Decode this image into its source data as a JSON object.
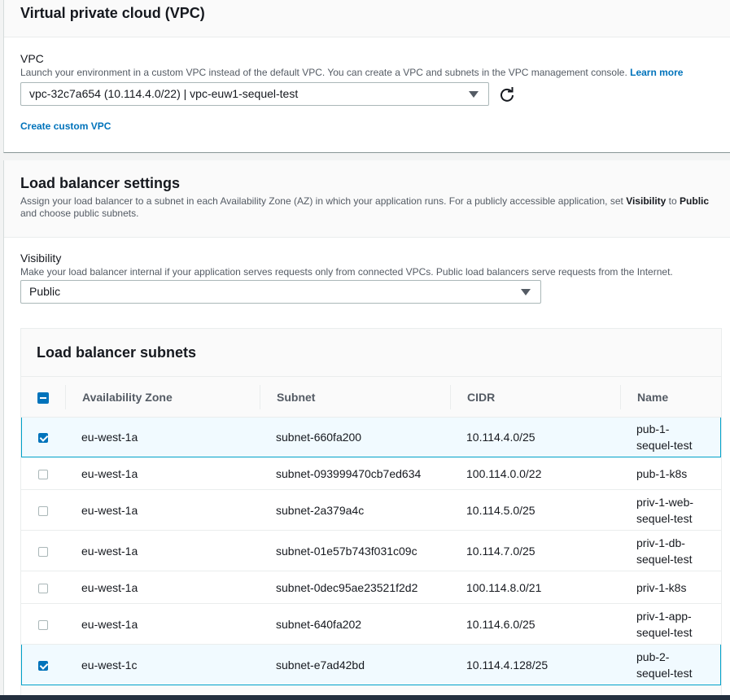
{
  "vpc": {
    "title": "Virtual private cloud (VPC)",
    "label": "VPC",
    "description": "Launch your environment in a custom VPC instead of the default VPC. You can create a VPC and subnets in the VPC management console.",
    "learn_more": "Learn more",
    "selected": "vpc-32c7a654 (10.114.4.0/22) | vpc-euw1-sequel-test",
    "create_link": "Create custom VPC"
  },
  "load_balancer": {
    "title": "Load balancer settings",
    "description_pre": "Assign your load balancer to a subnet in each Availability Zone (AZ) in which your application runs. For a publicly accessible application, set",
    "desc_visibility": "Visibility",
    "desc_to": "to",
    "desc_public": "Public",
    "description_post": "and choose public subnets.",
    "visibility_label": "Visibility",
    "visibility_desc": "Make your load balancer internal if your application serves requests only from connected VPCs. Public load balancers serve requests from the Internet.",
    "visibility_value": "Public"
  },
  "subnets": {
    "title": "Load balancer subnets",
    "columns": [
      "Availability Zone",
      "Subnet",
      "CIDR",
      "Name"
    ],
    "rows": [
      {
        "checked": true,
        "az": "eu-west-1a",
        "subnet": "subnet-660fa200",
        "cidr": "10.114.4.0/25",
        "name": [
          "pub-1-",
          "sequel-test"
        ]
      },
      {
        "checked": false,
        "az": "eu-west-1a",
        "subnet": "subnet-093999470cb7ed634",
        "cidr": "100.114.0.0/22",
        "name": [
          "pub-1-k8s"
        ]
      },
      {
        "checked": false,
        "az": "eu-west-1a",
        "subnet": "subnet-2a379a4c",
        "cidr": "10.114.5.0/25",
        "name": [
          "priv-1-web-",
          "sequel-test"
        ]
      },
      {
        "checked": false,
        "az": "eu-west-1a",
        "subnet": "subnet-01e57b743f031c09c",
        "cidr": "10.114.7.0/25",
        "name": [
          "priv-1-db-",
          "sequel-test"
        ]
      },
      {
        "checked": false,
        "az": "eu-west-1a",
        "subnet": "subnet-0dec95ae23521f2d2",
        "cidr": "100.114.8.0/21",
        "name": [
          "priv-1-k8s"
        ]
      },
      {
        "checked": false,
        "az": "eu-west-1a",
        "subnet": "subnet-640fa202",
        "cidr": "10.114.6.0/25",
        "name": [
          "priv-1-app-",
          "sequel-test"
        ]
      },
      {
        "checked": true,
        "az": "eu-west-1c",
        "subnet": "subnet-e7ad42bd",
        "cidr": "10.114.4.128/25",
        "name": [
          "pub-2-",
          "sequel-test"
        ]
      }
    ]
  }
}
